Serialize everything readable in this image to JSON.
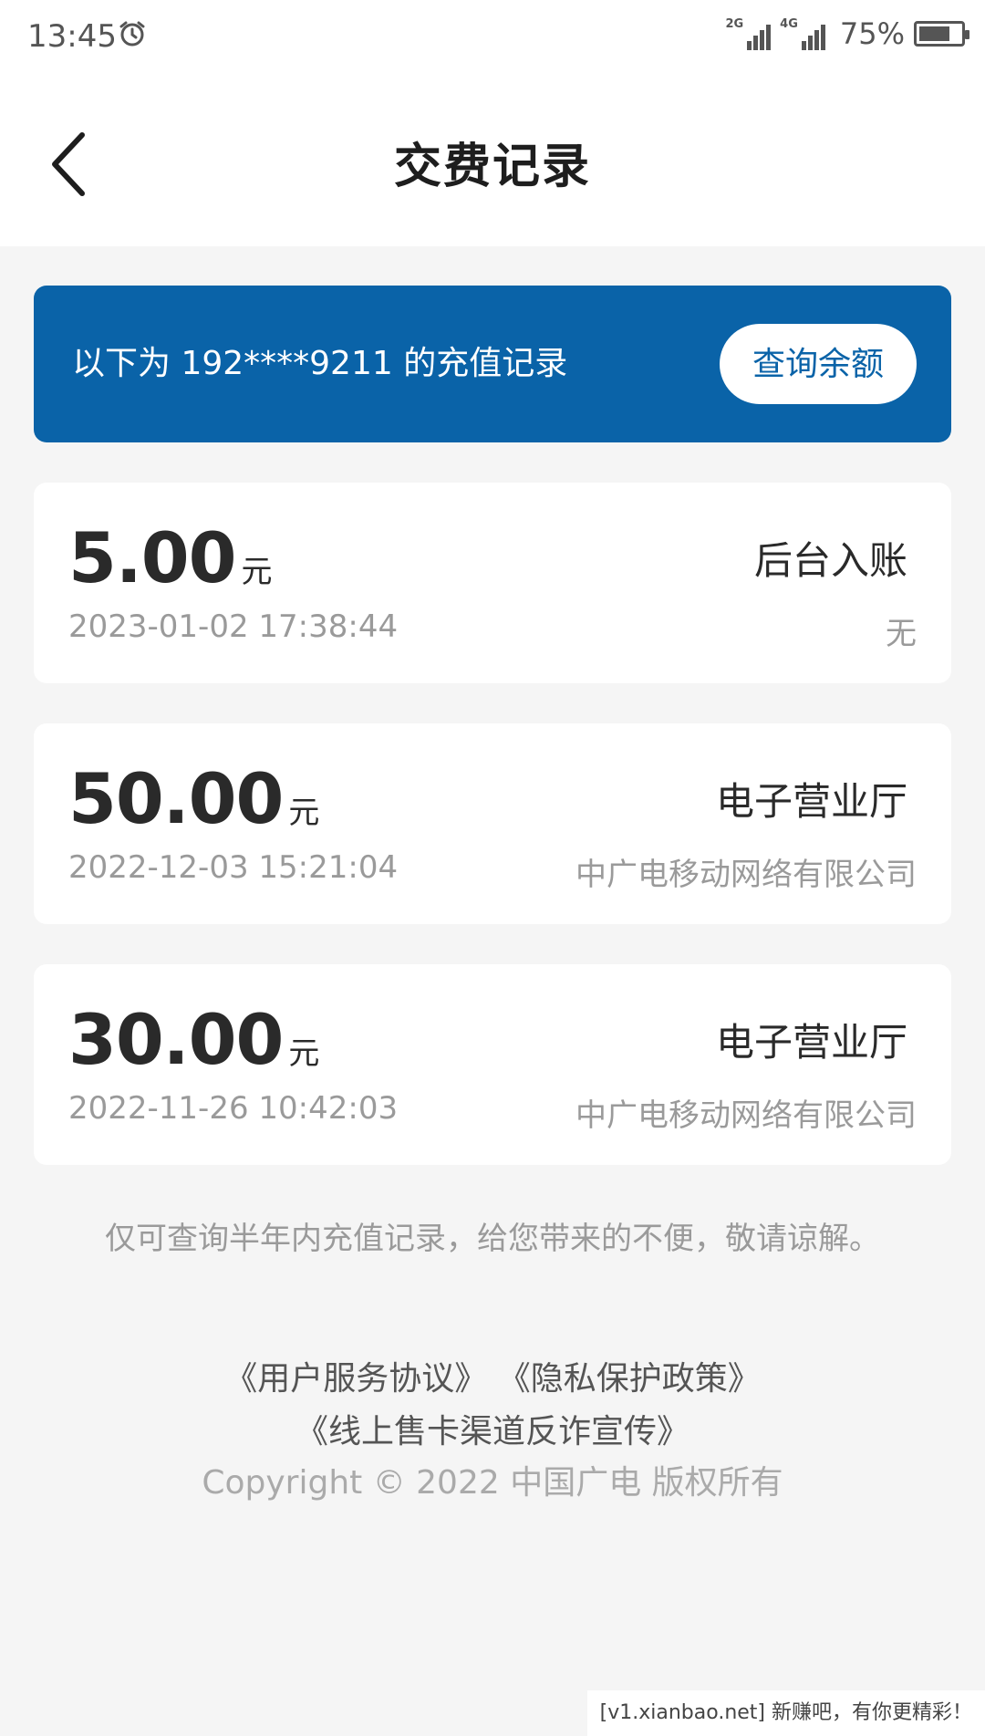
{
  "status_bar": {
    "time": "13:45",
    "network_1": "2G",
    "network_2": "4G",
    "battery_percent": "75%",
    "battery_level": 0.75
  },
  "header": {
    "title": "交费记录"
  },
  "banner": {
    "text": "以下为 192****9211 的充值记录",
    "button_label": "查询余额"
  },
  "records": [
    {
      "amount": "5.00",
      "unit": "元",
      "date": "2023-01-02 17:38:44",
      "type": "后台入账",
      "org": "无"
    },
    {
      "amount": "50.00",
      "unit": "元",
      "date": "2022-12-03 15:21:04",
      "type": "电子营业厅",
      "org": "中广电移动网络有限公司"
    },
    {
      "amount": "30.00",
      "unit": "元",
      "date": "2022-11-26 10:42:03",
      "type": "电子营业厅",
      "org": "中广电移动网络有限公司"
    }
  ],
  "notice": "仅可查询半年内充值记录，给您带来的不便，敬请谅解。",
  "footer": {
    "link_user_agreement": "《用户服务协议》",
    "link_privacy": "《隐私保护政策》",
    "link_anti_fraud": "《线上售卡渠道反诈宣传》",
    "copyright": "Copyright © 2022  中国广电  版权所有"
  },
  "watermark": "[v1.xianbao.net] 新赚吧，有你更精彩！"
}
